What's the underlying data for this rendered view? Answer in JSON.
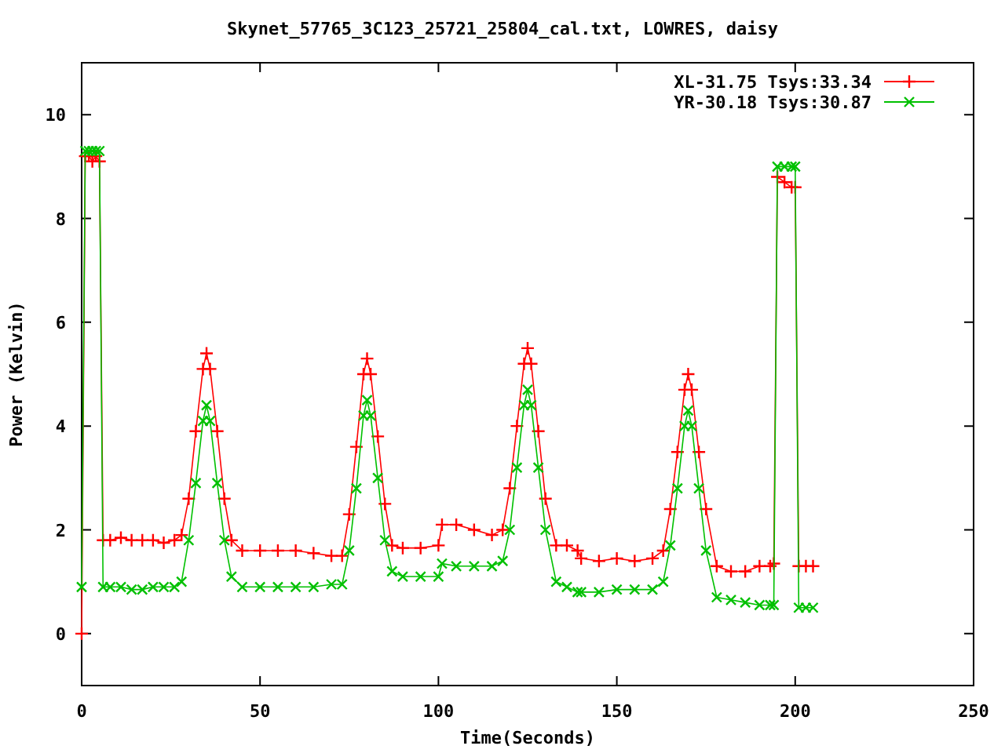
{
  "chart_data": {
    "type": "line",
    "title": "Skynet_57765_3C123_25721_25804_cal.txt, LOWRES, daisy",
    "xlabel": "Time(Seconds)",
    "ylabel": "Power (Kelvin)",
    "x": [
      0,
      1,
      2,
      3,
      4,
      5,
      6,
      8,
      11,
      14,
      17,
      20,
      23,
      26,
      28,
      30,
      32,
      34,
      35,
      36,
      38,
      40,
      42,
      45,
      50,
      55,
      60,
      65,
      70,
      73,
      75,
      77,
      79,
      80,
      81,
      83,
      85,
      87,
      90,
      95,
      100,
      101,
      105,
      110,
      115,
      118,
      120,
      122,
      124,
      125,
      126,
      128,
      130,
      133,
      136,
      139,
      140,
      145,
      150,
      155,
      160,
      163,
      165,
      167,
      169,
      170,
      171,
      173,
      175,
      178,
      182,
      186,
      190,
      193,
      194,
      195,
      197,
      199,
      200,
      201,
      203,
      205
    ],
    "series": [
      {
        "name": "XL-31.75 Tsys:33.34",
        "color": "#ff0000",
        "marker": "plus",
        "values": [
          0,
          9.2,
          9.2,
          9.1,
          9.2,
          9.1,
          1.8,
          1.8,
          1.85,
          1.8,
          1.8,
          1.8,
          1.75,
          1.8,
          1.9,
          2.6,
          3.9,
          5.1,
          5.4,
          5.1,
          3.9,
          2.6,
          1.8,
          1.6,
          1.6,
          1.6,
          1.6,
          1.55,
          1.5,
          1.5,
          2.3,
          3.6,
          5.0,
          5.3,
          5.0,
          3.8,
          2.5,
          1.7,
          1.65,
          1.65,
          1.7,
          2.1,
          2.1,
          2.0,
          1.9,
          2.0,
          2.8,
          4.0,
          5.2,
          5.5,
          5.2,
          3.9,
          2.6,
          1.7,
          1.7,
          1.6,
          1.45,
          1.4,
          1.45,
          1.4,
          1.45,
          1.6,
          2.4,
          3.5,
          4.7,
          5.0,
          4.7,
          3.5,
          2.4,
          1.3,
          1.2,
          1.2,
          1.3,
          1.3,
          1.35,
          8.8,
          8.7,
          8.6,
          8.6,
          1.3,
          1.3,
          1.3
        ]
      },
      {
        "name": "YR-30.18 Tsys:30.87",
        "color": "#00c000",
        "marker": "cross",
        "values": [
          0.9,
          9.3,
          9.3,
          9.3,
          9.3,
          9.3,
          0.9,
          0.9,
          0.9,
          0.85,
          0.85,
          0.9,
          0.9,
          0.9,
          1.0,
          1.8,
          2.9,
          4.1,
          4.4,
          4.1,
          2.9,
          1.8,
          1.1,
          0.9,
          0.9,
          0.9,
          0.9,
          0.9,
          0.95,
          0.95,
          1.6,
          2.8,
          4.2,
          4.5,
          4.2,
          3.0,
          1.8,
          1.2,
          1.1,
          1.1,
          1.1,
          1.35,
          1.3,
          1.3,
          1.3,
          1.4,
          2.0,
          3.2,
          4.4,
          4.7,
          4.4,
          3.2,
          2.0,
          1.0,
          0.9,
          0.8,
          0.8,
          0.8,
          0.85,
          0.85,
          0.85,
          1.0,
          1.7,
          2.8,
          4.0,
          4.3,
          4.0,
          2.8,
          1.6,
          0.7,
          0.65,
          0.6,
          0.55,
          0.55,
          0.55,
          9.0,
          9.0,
          9.0,
          9.0,
          0.5,
          0.5,
          0.5
        ]
      }
    ],
    "legend": true,
    "xlim": [
      0,
      250
    ],
    "ylim": [
      -1,
      11
    ],
    "xticks": [
      0,
      50,
      100,
      150,
      200,
      250
    ],
    "yticks": [
      0,
      2,
      4,
      6,
      8,
      10
    ]
  }
}
